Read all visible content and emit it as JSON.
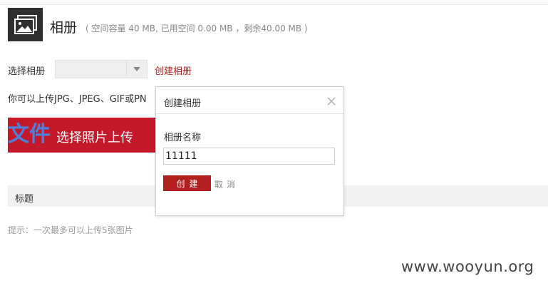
{
  "header": {
    "title": "相册",
    "quota": "( 空间容量 40 MB, 已用空间 0.00 MB ，剩余40.00 MB )",
    "icon": "image-icon"
  },
  "album_picker": {
    "label": "选择相册",
    "selected": "",
    "create_link": "创建相册"
  },
  "upload": {
    "hint": "你可以上传JPG、JPEG、GIF或PN",
    "ghost_text": "文件",
    "button_label": "选择照片上传"
  },
  "table": {
    "columns": [
      "标题"
    ]
  },
  "tip": "提示：一次最多可以上传5张图片",
  "dialog": {
    "title": "创建相册",
    "field_label": "相册名称",
    "name_value": "11111",
    "create_label": "创建",
    "cancel_label": "取消"
  },
  "watermark": "www.wooyun.org",
  "colors": {
    "accent": "#c3192a",
    "link": "#b22222",
    "icon_bg": "#2f2f2f"
  }
}
